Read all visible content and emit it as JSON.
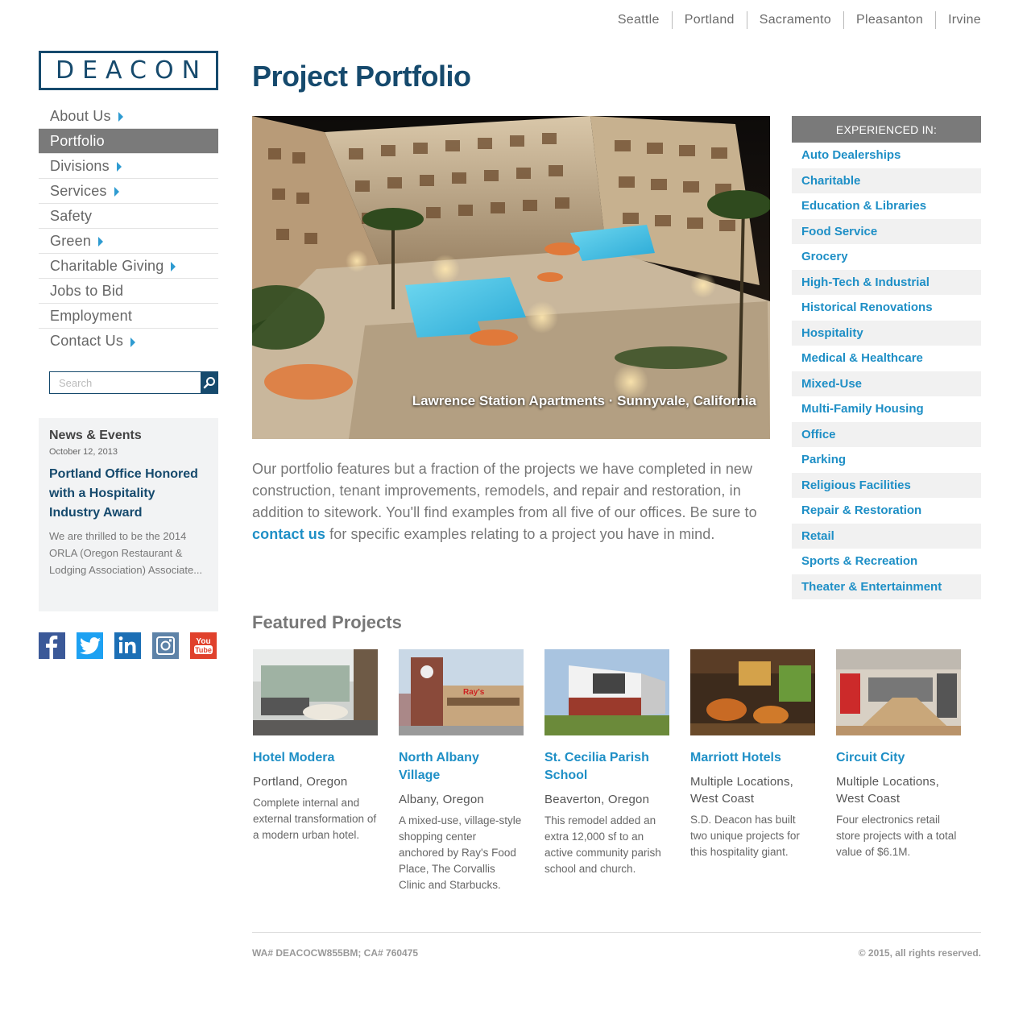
{
  "offices": [
    "Seattle",
    "Portland",
    "Sacramento",
    "Pleasanton",
    "Irvine"
  ],
  "logo": "DEACON",
  "nav": [
    {
      "label": "About Us",
      "arrow": true
    },
    {
      "label": "Portfolio",
      "arrow": false,
      "active": true
    },
    {
      "label": "Divisions",
      "arrow": true
    },
    {
      "label": "Services",
      "arrow": true
    },
    {
      "label": "Safety",
      "arrow": false
    },
    {
      "label": "Green",
      "arrow": true
    },
    {
      "label": "Charitable Giving",
      "arrow": true
    },
    {
      "label": "Jobs to Bid",
      "arrow": false
    },
    {
      "label": "Employment",
      "arrow": false
    },
    {
      "label": "Contact Us",
      "arrow": true
    }
  ],
  "search": {
    "placeholder": "Search"
  },
  "news": {
    "heading": "News & Events",
    "date": "October 12, 2013",
    "title": "Portland Office Honored with a Hospitality Industry Award",
    "excerpt": "We are thrilled to be the 2014 ORLA (Oregon Restaurant & Lodging Association) Associate..."
  },
  "social": [
    {
      "icon": "facebook-icon",
      "glyph": "f",
      "color": "#3b5998"
    },
    {
      "icon": "twitter-icon",
      "glyph": "t",
      "color": "#1da1f2"
    },
    {
      "icon": "linkedin-icon",
      "glyph": "in",
      "color": "#1c6fb5"
    },
    {
      "icon": "instagram-icon",
      "glyph": "◎",
      "color": "#5e83a8"
    },
    {
      "icon": "youtube-icon",
      "glyph": "You Tube",
      "color": "#e0412c"
    }
  ],
  "main": {
    "title": "Project Portfolio",
    "hero_caption": "Lawrence Station Apartments · Sunnyvale, California",
    "intro_before": "Our portfolio features but a fraction of the projects we have completed in new construction, tenant improvements, remodels, and repair and restoration, in addition to sitework. You'll find examples from all five of our offices. Be sure to ",
    "intro_link": "contact us",
    "intro_after": " for specific examples relating to a project you have in mind.",
    "featured_heading": "Featured Projects"
  },
  "projects": [
    {
      "name": "Hotel Modera",
      "location": "Portland, Oregon",
      "desc": "Complete internal and external transformation of a modern urban hotel."
    },
    {
      "name": "North Albany Village",
      "location": "Albany, Oregon",
      "desc": "A mixed-use, village-style shopping center anchored by Ray's Food Place, The Corvallis Clinic and Starbucks."
    },
    {
      "name": "St. Cecilia Parish School",
      "location": "Beaverton, Oregon",
      "desc": "This remodel added an extra 12,000 sf to an active community parish school and church."
    },
    {
      "name": "Marriott Hotels",
      "location": "Multiple Locations, West Coast",
      "desc": "S.D. Deacon has built two unique projects for this hospitality giant."
    },
    {
      "name": "Circuit City",
      "location": "Multiple Locations, West Coast",
      "desc": "Four electronics retail store projects with a total value of $6.1M."
    }
  ],
  "experience": {
    "header": "EXPERIENCED IN:",
    "items": [
      "Auto Dealerships",
      "Charitable",
      "Education & Libraries",
      "Food Service",
      "Grocery",
      "High-Tech & Industrial",
      "Historical Renovations",
      "Hospitality",
      "Medical & Healthcare",
      "Mixed-Use",
      "Multi-Family Housing",
      "Office",
      "Parking",
      "Religious Facilities",
      "Repair & Restoration",
      "Retail",
      "Sports & Recreation",
      "Theater & Entertainment"
    ]
  },
  "footer": {
    "license": "WA# DEACOCW855BM; CA# 760475",
    "copyright": "© 2015, all rights reserved."
  }
}
